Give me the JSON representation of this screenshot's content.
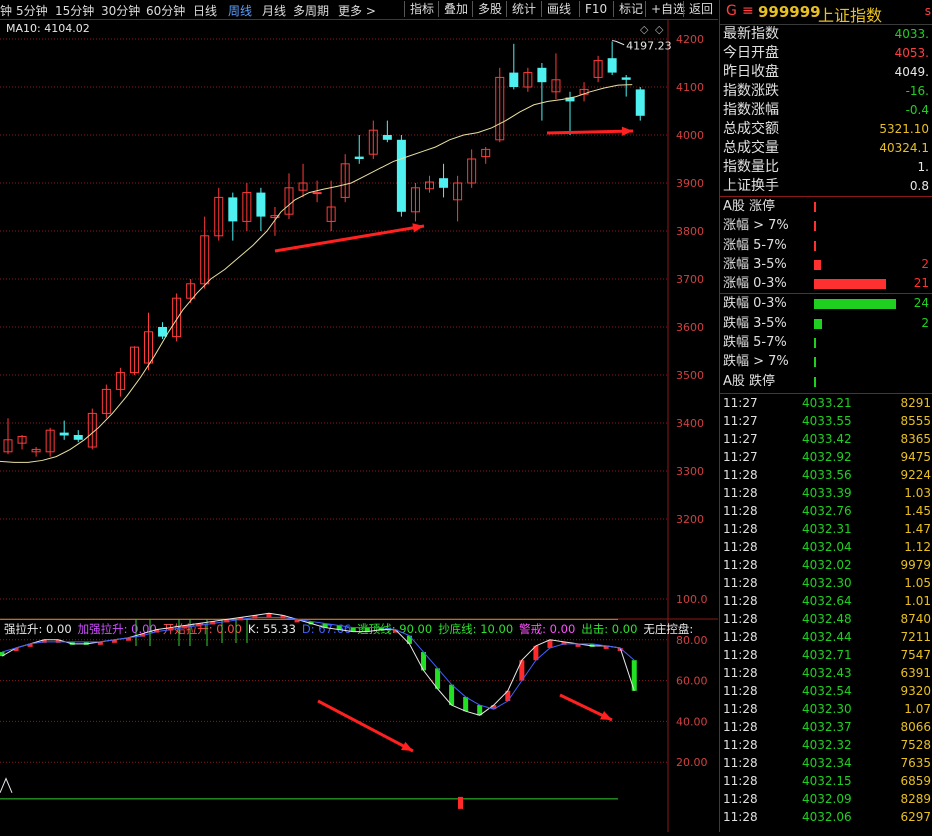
{
  "toolbar": {
    "timeframes": [
      "钟",
      "5分钟",
      "15分钟",
      "30分钟",
      "60分钟",
      "日线",
      "周线",
      "月线",
      "多周期",
      "更多 >"
    ],
    "active_index": 6,
    "buttons": [
      "指标",
      "叠加",
      "多股",
      "统计",
      "画线",
      "F10",
      "标记",
      "+自选",
      "返回"
    ]
  },
  "chart": {
    "ma_label": "MA10: 4104.02",
    "high_label": "4197.23",
    "price_ticks": [
      "4200",
      "4100",
      "4000",
      "3900",
      "3800",
      "3700",
      "3600",
      "3500",
      "3400",
      "3300",
      "3200"
    ],
    "indicator_labels": [
      {
        "text": "强拉升: 0.00",
        "color": "#e8e8e8"
      },
      {
        "text": "加强拉升: 0.00",
        "color": "#d050ff"
      },
      {
        "text": "开始拉升: 0.00",
        "color": "#ff5050"
      },
      {
        "text": "K: 55.33",
        "color": "#e8e8e8"
      },
      {
        "text": "D: 67.66",
        "color": "#4060ff"
      },
      {
        "text": "逃顶线: 90.00",
        "color": "#30e030"
      },
      {
        "text": "抄底线: 10.00",
        "color": "#30e030"
      },
      {
        "text": "警戒: 0.00",
        "color": "#ff50ff"
      },
      {
        "text": "出击: 0.00",
        "color": "#30e030"
      },
      {
        "text": "无庄控盘:",
        "color": "#e8e8e8"
      }
    ],
    "osc_ticks": [
      "100.0",
      "80.00",
      "60.00",
      "40.00",
      "20.00"
    ]
  },
  "chart_data": {
    "type": "candlestick",
    "price_range": [
      3140,
      4240
    ],
    "ma10_label_value": 4104.02,
    "high_marker": 4197.23,
    "candles": [
      {
        "o": 3340,
        "c": 3365,
        "h": 3410,
        "l": 3335
      },
      {
        "o": 3358,
        "c": 3372,
        "h": 3375,
        "l": 3345
      },
      {
        "o": 3340,
        "c": 3345,
        "h": 3350,
        "l": 3330
      },
      {
        "o": 3340,
        "c": 3385,
        "h": 3390,
        "l": 3330
      },
      {
        "o": 3380,
        "c": 3374,
        "h": 3405,
        "l": 3365
      },
      {
        "o": 3375,
        "c": 3365,
        "h": 3385,
        "l": 3360
      },
      {
        "o": 3350,
        "c": 3420,
        "h": 3430,
        "l": 3345
      },
      {
        "o": 3420,
        "c": 3470,
        "h": 3480,
        "l": 3410
      },
      {
        "o": 3470,
        "c": 3505,
        "h": 3515,
        "l": 3455
      },
      {
        "o": 3505,
        "c": 3558,
        "h": 3560,
        "l": 3500
      },
      {
        "o": 3525,
        "c": 3590,
        "h": 3630,
        "l": 3510
      },
      {
        "o": 3600,
        "c": 3580,
        "h": 3610,
        "l": 3575
      },
      {
        "o": 3580,
        "c": 3660,
        "h": 3670,
        "l": 3570
      },
      {
        "o": 3660,
        "c": 3690,
        "h": 3700,
        "l": 3650
      },
      {
        "o": 3690,
        "c": 3790,
        "h": 3830,
        "l": 3680
      },
      {
        "o": 3790,
        "c": 3870,
        "h": 3890,
        "l": 3780
      },
      {
        "o": 3870,
        "c": 3820,
        "h": 3880,
        "l": 3780
      },
      {
        "o": 3820,
        "c": 3880,
        "h": 3900,
        "l": 3800
      },
      {
        "o": 3880,
        "c": 3830,
        "h": 3890,
        "l": 3800
      },
      {
        "o": 3828,
        "c": 3832,
        "h": 3850,
        "l": 3790
      },
      {
        "o": 3835,
        "c": 3890,
        "h": 3920,
        "l": 3825
      },
      {
        "o": 3885,
        "c": 3900,
        "h": 3940,
        "l": 3870
      },
      {
        "o": 3880,
        "c": 3880,
        "h": 3905,
        "l": 3860
      },
      {
        "o": 3820,
        "c": 3850,
        "h": 3905,
        "l": 3800
      },
      {
        "o": 3870,
        "c": 3940,
        "h": 3960,
        "l": 3860
      },
      {
        "o": 3955,
        "c": 3950,
        "h": 4000,
        "l": 3940
      },
      {
        "o": 3960,
        "c": 4010,
        "h": 4030,
        "l": 3950
      },
      {
        "o": 4000,
        "c": 3990,
        "h": 4030,
        "l": 3985
      },
      {
        "o": 3990,
        "c": 3840,
        "h": 4000,
        "l": 3830
      },
      {
        "o": 3840,
        "c": 3890,
        "h": 3900,
        "l": 3820
      },
      {
        "o": 3888,
        "c": 3902,
        "h": 3915,
        "l": 3880
      },
      {
        "o": 3910,
        "c": 3890,
        "h": 3940,
        "l": 3870
      },
      {
        "o": 3865,
        "c": 3900,
        "h": 3915,
        "l": 3820
      },
      {
        "o": 3900,
        "c": 3950,
        "h": 3970,
        "l": 3890
      },
      {
        "o": 3955,
        "c": 3970,
        "h": 3975,
        "l": 3940
      },
      {
        "o": 3990,
        "c": 4120,
        "h": 4140,
        "l": 3985
      },
      {
        "o": 4130,
        "c": 4100,
        "h": 4190,
        "l": 4095
      },
      {
        "o": 4100,
        "c": 4130,
        "h": 4140,
        "l": 4090
      },
      {
        "o": 4140,
        "c": 4110,
        "h": 4150,
        "l": 4030
      },
      {
        "o": 4090,
        "c": 4115,
        "h": 4170,
        "l": 4075
      },
      {
        "o": 4078,
        "c": 4070,
        "h": 4090,
        "l": 4000
      },
      {
        "o": 4085,
        "c": 4095,
        "h": 4110,
        "l": 4070
      },
      {
        "o": 4120,
        "c": 4155,
        "h": 4165,
        "l": 4110
      },
      {
        "o": 4160,
        "c": 4130,
        "h": 4195,
        "l": 4125
      },
      {
        "o": 4120,
        "c": 4115,
        "h": 4125,
        "l": 4080
      },
      {
        "o": 4095,
        "c": 4040,
        "h": 4100,
        "l": 4030
      }
    ],
    "ma10": [
      3320,
      3318,
      3318,
      3322,
      3330,
      3345,
      3365,
      3390,
      3420,
      3455,
      3495,
      3540,
      3590,
      3635,
      3670,
      3700,
      3720,
      3745,
      3770,
      3800,
      3840,
      3865,
      3880,
      3887,
      3893,
      3900,
      3915,
      3930,
      3945,
      3955,
      3965,
      3975,
      3990,
      4000,
      4005,
      4015,
      4030,
      4048,
      4063,
      4070,
      4074,
      4080,
      4090,
      4098,
      4104,
      4105
    ],
    "osc_range": [
      0,
      100
    ],
    "k_line": [
      72,
      76,
      78,
      80,
      80,
      78,
      78,
      79,
      80,
      81,
      83,
      85,
      86,
      87,
      88,
      89,
      90,
      91,
      92,
      93,
      92,
      90,
      88,
      86,
      85,
      84,
      84,
      85,
      85,
      78,
      65,
      56,
      48,
      45,
      43,
      48,
      55,
      70,
      77,
      80,
      79,
      78,
      77,
      77,
      76,
      55
    ],
    "d_line": [
      74,
      76,
      78,
      79,
      79,
      79,
      79,
      79,
      80,
      81,
      82,
      84,
      85,
      86,
      87,
      88,
      89,
      90,
      91,
      91,
      91,
      90,
      89,
      88,
      87,
      86,
      86,
      86,
      85,
      82,
      74,
      66,
      58,
      52,
      48,
      46,
      50,
      60,
      70,
      76,
      78,
      78,
      78,
      77,
      76,
      70
    ]
  },
  "quote": {
    "code": "999999",
    "name": "上证指数",
    "stats": [
      {
        "label": "最新指数",
        "value": "4033.",
        "color": "#20d020"
      },
      {
        "label": "今日开盘",
        "value": "4053.",
        "color": "#ff4040"
      },
      {
        "label": "昨日收盘",
        "value": "4049.",
        "color": "#e8e8e8"
      },
      {
        "label": "指数涨跌",
        "value": "-16.",
        "color": "#20d020"
      },
      {
        "label": "指数涨幅",
        "value": "-0.4",
        "color": "#20d020"
      },
      {
        "label": "总成交额",
        "value": "5321.10",
        "color": "#e8c020"
      },
      {
        "label": "总成交量",
        "value": "40324.1",
        "color": "#e8c020"
      },
      {
        "label": "指数量比",
        "value": "1.",
        "color": "#e8e8e8"
      },
      {
        "label": "上证换手",
        "value": "0.8",
        "color": "#e8e8e8"
      }
    ],
    "up_breadth": [
      {
        "label": "A股 涨停",
        "count": "",
        "frac": 0.01
      },
      {
        "label": "涨幅 > 7%",
        "count": "",
        "frac": 0.01
      },
      {
        "label": "涨幅 5-7%",
        "count": "",
        "frac": 0.02
      },
      {
        "label": "涨幅 3-5%",
        "count": "2",
        "frac": 0.08
      },
      {
        "label": "涨幅 0-3%",
        "count": "21",
        "frac": 0.85
      }
    ],
    "down_breadth": [
      {
        "label": "跌幅 0-3%",
        "count": "24",
        "frac": 0.97
      },
      {
        "label": "跌幅 3-5%",
        "count": "2",
        "frac": 0.09
      },
      {
        "label": "跌幅 5-7%",
        "count": "",
        "frac": 0.01
      },
      {
        "label": "跌幅 > 7%",
        "count": "",
        "frac": 0.01
      },
      {
        "label": "A股 跌停",
        "count": "",
        "frac": 0.01
      }
    ],
    "ticks": [
      {
        "t": "11:27",
        "p": "4033.21",
        "v": "8291"
      },
      {
        "t": "11:27",
        "p": "4033.55",
        "v": "8555"
      },
      {
        "t": "11:27",
        "p": "4033.42",
        "v": "8365"
      },
      {
        "t": "11:27",
        "p": "4032.92",
        "v": "9475"
      },
      {
        "t": "11:28",
        "p": "4033.56",
        "v": "9224"
      },
      {
        "t": "11:28",
        "p": "4033.39",
        "v": "1.03"
      },
      {
        "t": "11:28",
        "p": "4032.76",
        "v": "1.45"
      },
      {
        "t": "11:28",
        "p": "4032.31",
        "v": "1.47"
      },
      {
        "t": "11:28",
        "p": "4032.04",
        "v": "1.12"
      },
      {
        "t": "11:28",
        "p": "4032.02",
        "v": "9979"
      },
      {
        "t": "11:28",
        "p": "4032.30",
        "v": "1.05"
      },
      {
        "t": "11:28",
        "p": "4032.64",
        "v": "1.01"
      },
      {
        "t": "11:28",
        "p": "4032.48",
        "v": "8740"
      },
      {
        "t": "11:28",
        "p": "4032.44",
        "v": "7211"
      },
      {
        "t": "11:28",
        "p": "4032.71",
        "v": "7547"
      },
      {
        "t": "11:28",
        "p": "4032.43",
        "v": "6391"
      },
      {
        "t": "11:28",
        "p": "4032.54",
        "v": "9320"
      },
      {
        "t": "11:28",
        "p": "4032.30",
        "v": "1.07"
      },
      {
        "t": "11:28",
        "p": "4032.37",
        "v": "8066"
      },
      {
        "t": "11:28",
        "p": "4032.32",
        "v": "7528"
      },
      {
        "t": "11:28",
        "p": "4032.34",
        "v": "7635"
      },
      {
        "t": "11:28",
        "p": "4032.15",
        "v": "6859"
      },
      {
        "t": "11:28",
        "p": "4032.09",
        "v": "8289"
      },
      {
        "t": "11:28",
        "p": "4032.06",
        "v": "6297"
      }
    ]
  },
  "colors": {
    "up": "#ff3b3b",
    "down": "#4ff0f0",
    "ma": "#e8e0a0",
    "grid": "#8a1a1a",
    "green": "#20d020"
  }
}
